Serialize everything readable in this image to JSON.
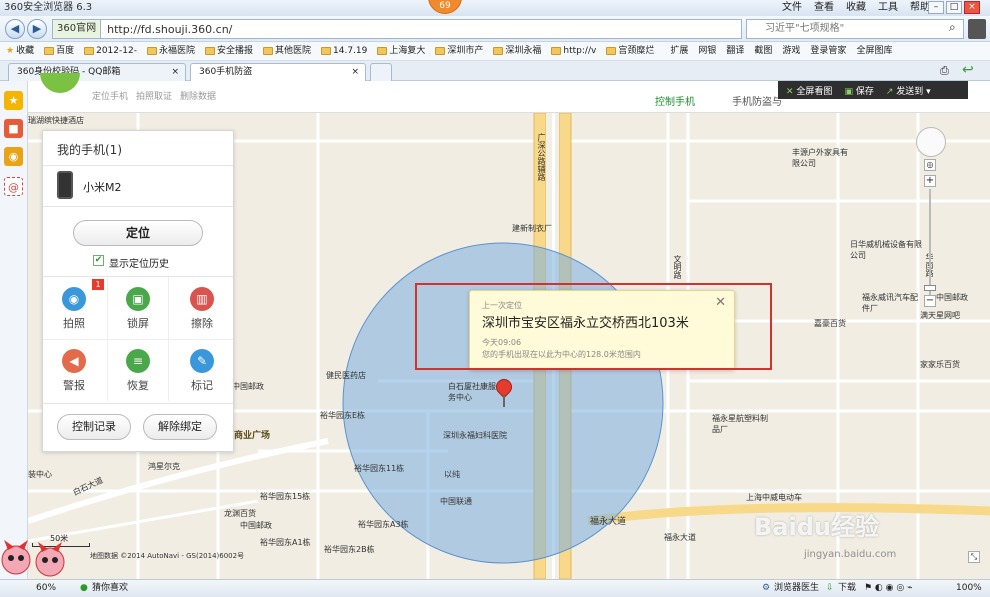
{
  "browser": {
    "title": "360安全浏览器 6.3",
    "badge": "69",
    "menu": [
      "文件",
      "查看",
      "收藏",
      "工具",
      "帮助"
    ],
    "address_tag": "360官网",
    "url": "http://fd.shouji.360.cn/",
    "search_placeholder": "习近平\"七项规格\"",
    "bookmarks": [
      "收藏",
      "百度",
      "2012-12-",
      "永福医院",
      "安全播报",
      "其他医院",
      "14.7.19",
      "上海复大",
      "深圳市产",
      "深圳永福",
      "http://v",
      "宫颈糜烂",
      "扩展",
      "网银",
      "翻译",
      "截图",
      "游戏",
      "登录管家",
      "全屏图库"
    ],
    "tabs": [
      {
        "label": "360身份校验码 - QQ邮箱",
        "active": false
      },
      {
        "label": "360手机防盗",
        "active": true
      }
    ]
  },
  "page": {
    "nav": [
      "定位手机",
      "拍照取证",
      "删除数据"
    ],
    "control_tab": "控制手机",
    "guard_tab": "手机防盗与",
    "tools": [
      "全屏看图",
      "保存",
      "发送到"
    ]
  },
  "panel": {
    "title": "我的手机(1)",
    "device": "小米M2",
    "locate": "定位",
    "show_history": "显示定位历史",
    "actions": [
      {
        "label": "拍照",
        "icon": "camera-icon",
        "color": "#3a97d9",
        "badge": "1"
      },
      {
        "label": "锁屏",
        "icon": "lock-icon",
        "color": "#4aa84a",
        "badge": ""
      },
      {
        "label": "擦除",
        "icon": "trash-icon",
        "color": "#d9534f",
        "badge": ""
      },
      {
        "label": "警报",
        "icon": "speaker-icon",
        "color": "#e26b4c",
        "badge": ""
      },
      {
        "label": "恢复",
        "icon": "restore-icon",
        "color": "#4aa84a",
        "badge": ""
      },
      {
        "label": "标记",
        "icon": "pencil-icon",
        "color": "#3a97d9",
        "badge": ""
      }
    ],
    "records": "控制记录",
    "unbind": "解除绑定"
  },
  "popup": {
    "header": "上一次定位",
    "address": "深圳市宝安区福永立交桥西北103米",
    "time": "今天09:06",
    "note": "您的手机出现在以此为中心的128.0米范围内"
  },
  "map_labels": [
    "瑞湖缤快捷酒店",
    "建新制衣厂",
    "丰源户外家具有限公司",
    "日华威机械设备有限公司",
    "福永威讯汽车配件厂",
    "中国邮政",
    "满天星网吧",
    "嘉豪百货",
    "家家乐百货",
    "健民医药店",
    "白石厦社康服务中心",
    "中国邮政",
    "深圳永福妇科医院",
    "裕华园东E栋",
    "商业广场",
    "鸿星尔克",
    "以纯",
    "裕华园东11栋",
    "福永星航塑料制品厂",
    "装中心",
    "裕华园东15栋",
    "白石大道",
    "龙渊百货",
    "中国联通",
    "裕华园东A3栋",
    "上海中威电动车",
    "福永大道",
    "中国邮政",
    "裕华园东A1栋",
    "裕华园东2B栋",
    "福永大道",
    "广深公路辅路",
    "文明路",
    "华南路"
  ],
  "scale": "50米",
  "copyright": "地图数据 ©2014 AutoNavi - GS(2014)6002号",
  "status": {
    "left": "60%",
    "guess": "猜你喜欢",
    "doctor": "浏览器医生",
    "download": "下载",
    "zoom": "100%"
  },
  "watermark": "Baidu经验",
  "watermark_url": "jingyan.baidu.com"
}
